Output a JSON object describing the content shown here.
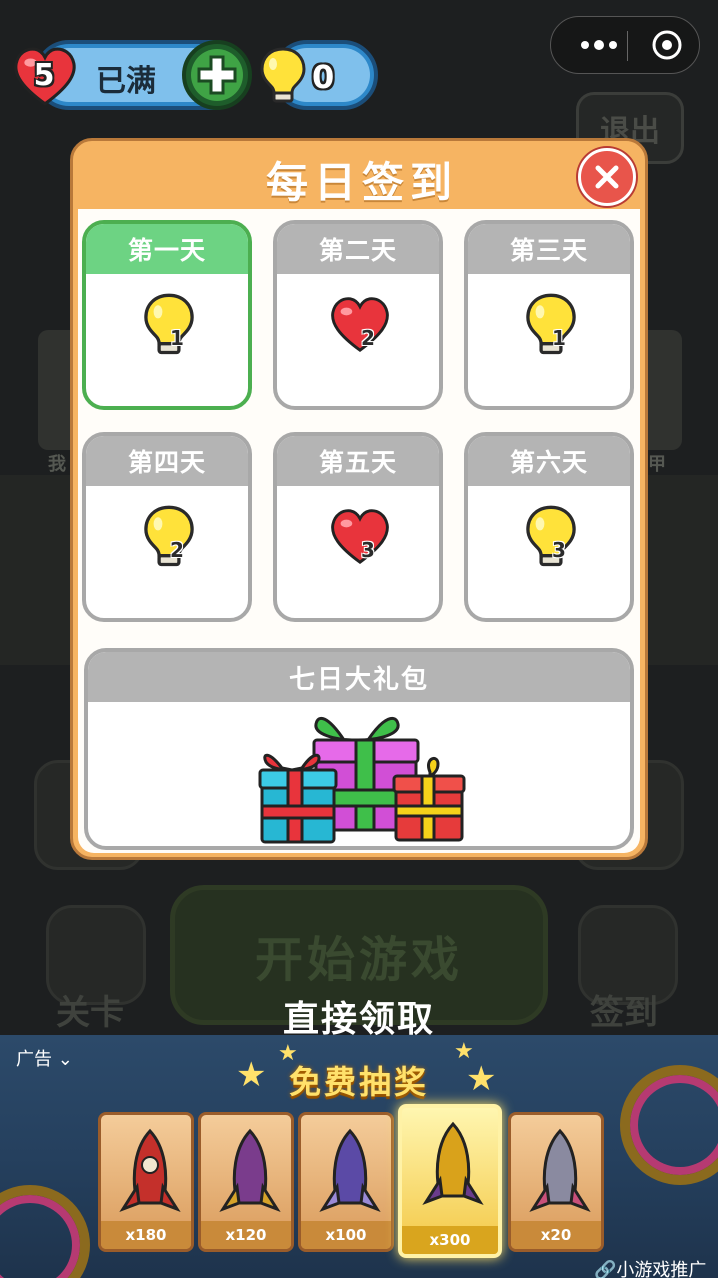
{
  "hud": {
    "lives_count": "5",
    "lives_status": "已满",
    "hints_count": "0"
  },
  "background": {
    "exit_label": "退出",
    "start_label": "开始游戏",
    "levels_label": "关卡",
    "signin_label": "签到"
  },
  "modal": {
    "title": "每日签到",
    "days": [
      {
        "label": "第一天",
        "reward": "bulb-icon",
        "count": "1",
        "active": true
      },
      {
        "label": "第二天",
        "reward": "heart-icon",
        "count": "2",
        "active": false
      },
      {
        "label": "第三天",
        "reward": "bulb-icon",
        "count": "1",
        "active": false
      },
      {
        "label": "第四天",
        "reward": "bulb-icon",
        "count": "2",
        "active": false
      },
      {
        "label": "第五天",
        "reward": "heart-icon",
        "count": "3",
        "active": false
      },
      {
        "label": "第六天",
        "reward": "bulb-icon",
        "count": "3",
        "active": false
      }
    ],
    "seventh_day_label": "七日大礼包"
  },
  "claim_link": "直接领取",
  "ad": {
    "label": "广告",
    "title": "免费抽奖",
    "cards": [
      {
        "amount": "x180",
        "color": "#c4302b"
      },
      {
        "amount": "x120",
        "color": "#7a3c8c"
      },
      {
        "amount": "x100",
        "color": "#5b4aa6"
      },
      {
        "amount": "x300",
        "color": "#d9a21b"
      },
      {
        "amount": "x20",
        "color": "#8a8aa0"
      }
    ],
    "footer": "小游戏推广"
  },
  "colors": {
    "modal_header": "#f6b462",
    "active_day": "#6dd383",
    "inactive_day": "#b4b4b4",
    "close_button": "#e8554b"
  }
}
